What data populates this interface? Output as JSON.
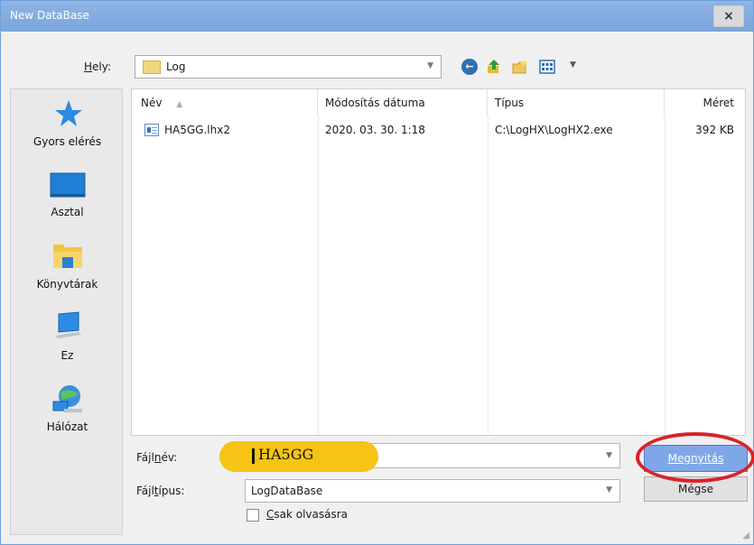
{
  "window": {
    "title": "New DataBase",
    "close_glyph": "×"
  },
  "location": {
    "label_underlined": "H",
    "label_rest": "ely:",
    "value": "Log",
    "arrow_glyph": "▼"
  },
  "toolbar": {
    "icons": [
      "back-icon",
      "up-folder-icon",
      "new-folder-icon",
      "views-menu-icon"
    ]
  },
  "places": {
    "items": [
      {
        "label": "Gyors elérés",
        "icon": "star-icon"
      },
      {
        "label": "Asztal",
        "icon": "desktop-icon"
      },
      {
        "label": "Könyvtárak",
        "icon": "libraries-icon"
      },
      {
        "label": "Ez",
        "icon": "computer-icon"
      },
      {
        "label": "Hálózat",
        "icon": "network-icon"
      }
    ]
  },
  "filelist": {
    "columns": [
      {
        "label": "Név",
        "sort_glyph": "▲"
      },
      {
        "label": "Módosítás dátuma"
      },
      {
        "label": "Típus"
      },
      {
        "label": "Méret"
      }
    ],
    "rows": [
      {
        "name": "HA5GG.lhx2",
        "modified": "2020. 03. 30. 1:18",
        "type": "C:\\LogHX\\LogHX2.exe",
        "size": "392 KB"
      }
    ]
  },
  "filename": {
    "label_pre": "Fájl",
    "label_underlined": "n",
    "label_post": "év:",
    "value": "HA5GG",
    "arrow_glyph": "▼"
  },
  "filetype": {
    "label_pre": "Fájl",
    "label_underlined": "t",
    "label_post": "ípus:",
    "value": "LogDataBase",
    "arrow_glyph": "▼"
  },
  "readonly": {
    "label_underlined": "C",
    "label_rest": "sak olvasásra",
    "checked": false
  },
  "buttons": {
    "open_label": "Megnyitás",
    "cancel_label": "Mégse"
  },
  "colors": {
    "title_bar": "#7aa6dc",
    "highlight": "#f5c415",
    "annotation_oval": "#d8232a",
    "primary_button": "#7fa7e8"
  }
}
